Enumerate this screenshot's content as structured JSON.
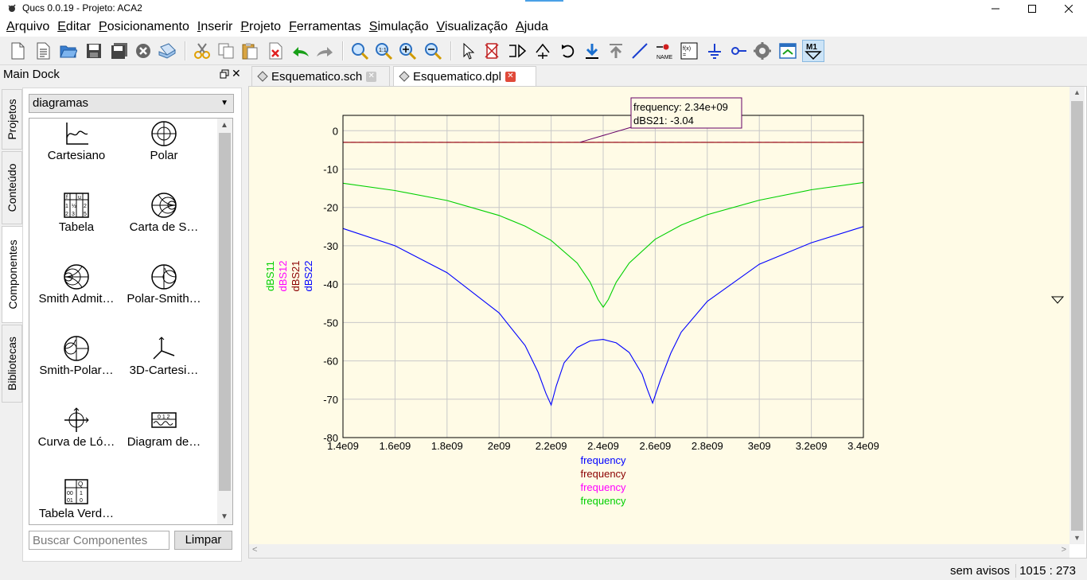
{
  "window": {
    "title": "Qucs 0.0.19 - Projeto: ACA2"
  },
  "menu": [
    "Arquivo",
    "Editar",
    "Posicionamento",
    "Inserir",
    "Projeto",
    "Ferramentas",
    "Simulação",
    "Visualização",
    "Ajuda"
  ],
  "toolbar": {
    "icons": [
      "new-file-icon",
      "new-text-icon",
      "open-icon",
      "save-icon",
      "save-all-icon",
      "close-doc-icon",
      "print-icon",
      "cut-icon",
      "copy-icon",
      "paste-icon",
      "delete-icon",
      "undo-icon",
      "redo-icon",
      "zoom-fit-icon",
      "zoom-1to1-icon",
      "zoom-in-icon",
      "zoom-out-icon",
      "select-icon",
      "deactivate-icon",
      "mirror-x-icon",
      "mirror-y-icon",
      "rotate-icon",
      "go-into-icon",
      "go-up-icon",
      "wire-icon",
      "label-icon",
      "equation-icon",
      "ground-icon",
      "port-icon",
      "simulate-icon",
      "view-data-icon",
      "marker-icon"
    ],
    "name_label": "NAME",
    "marker_label": "M1"
  },
  "dock": {
    "title": "Main Dock",
    "tabs": [
      "Projetos",
      "Conteúdo",
      "Componentes",
      "Bibliotecas"
    ],
    "category": "diagramas",
    "components": [
      {
        "label": "Cartesiano",
        "icon": "cartesian-icon"
      },
      {
        "label": "Polar",
        "icon": "polar-icon"
      },
      {
        "label": "Tabela",
        "icon": "table-icon"
      },
      {
        "label": "Carta de S…",
        "icon": "smith-chart-icon"
      },
      {
        "label": "Smith Admit…",
        "icon": "smith-admittance-icon"
      },
      {
        "label": "Polar-Smith…",
        "icon": "polar-smith-icon"
      },
      {
        "label": "Smith-Polar…",
        "icon": "smith-polar-icon"
      },
      {
        "label": "3D-Cartesi…",
        "icon": "3d-cartesian-icon"
      },
      {
        "label": "Curva de Ló…",
        "icon": "locus-curve-icon"
      },
      {
        "label": "Diagram de…",
        "icon": "timing-diagram-icon"
      },
      {
        "label": "Tabela Verd…",
        "icon": "truth-table-icon"
      }
    ],
    "table_icon_text": [
      "f",
      "u",
      "1",
      "½",
      "2",
      "2",
      "3",
      "5"
    ],
    "timing_icon_text": "0 1 2",
    "truth_icon_text": [
      "Q",
      "00",
      "1",
      "01",
      "0"
    ],
    "search_placeholder": "Buscar Componentes",
    "clear_label": "Limpar"
  },
  "doc_tabs": [
    {
      "label": "Esquematico.sch",
      "active": false,
      "close_color": "#8a8a8a"
    },
    {
      "label": "Esquematico.dpl",
      "active": true,
      "close_color": "#e04a3a"
    }
  ],
  "canvas_bg": "#fffbe6",
  "chart_data": {
    "type": "line",
    "xlabel": "frequency",
    "ylabel": "",
    "xlim": [
      1400000000.0,
      3400000000.0
    ],
    "ylim": [
      -80,
      4
    ],
    "x_ticks": [
      "1.4e09",
      "1.6e09",
      "1.8e09",
      "2e09",
      "2.2e09",
      "2.4e09",
      "2.6e09",
      "2.8e09",
      "3e09",
      "3.2e09",
      "3.4e09"
    ],
    "y_ticks": [
      "0",
      "-10",
      "-20",
      "-30",
      "-40",
      "-50",
      "-60",
      "-70",
      "-80"
    ],
    "grid": true,
    "y_legend": [
      {
        "name": "dBS11",
        "color": "#00d000"
      },
      {
        "name": "dBS12",
        "color": "#ff00ff"
      },
      {
        "name": "dBS21",
        "color": "#8b0000"
      },
      {
        "name": "dBS22",
        "color": "#0000ff"
      }
    ],
    "x_legend": [
      {
        "name": "frequency",
        "color": "#0000ff"
      },
      {
        "name": "frequency",
        "color": "#8b0000"
      },
      {
        "name": "frequency",
        "color": "#ff00ff"
      },
      {
        "name": "frequency",
        "color": "#00d000"
      }
    ],
    "series": [
      {
        "name": "dBS11",
        "color": "#00d000",
        "x": [
          1400000000.0,
          1600000000.0,
          1800000000.0,
          2000000000.0,
          2100000000.0,
          2200000000.0,
          2300000000.0,
          2350000000.0,
          2380000000.0,
          2400000000.0,
          2420000000.0,
          2450000000.0,
          2500000000.0,
          2600000000.0,
          2700000000.0,
          2800000000.0,
          3000000000.0,
          3200000000.0,
          3400000000.0
        ],
        "y": [
          -13.7,
          -15.6,
          -18.2,
          -22.1,
          -24.9,
          -28.6,
          -34.5,
          -39.5,
          -44,
          -46,
          -44,
          -39.5,
          -34.5,
          -28.3,
          -24.6,
          -21.9,
          -18.1,
          -15.4,
          -13.5
        ]
      },
      {
        "name": "dBS12",
        "color": "#ff00ff",
        "x": [
          1400000000.0,
          3400000000.0
        ],
        "y": [
          -3.04,
          -3.04
        ]
      },
      {
        "name": "dBS21",
        "color": "#8b0000",
        "x": [
          1400000000.0,
          3400000000.0
        ],
        "y": [
          -3.04,
          -3.04
        ]
      },
      {
        "name": "dBS22",
        "color": "#0000ff",
        "x": [
          1400000000.0,
          1600000000.0,
          1800000000.0,
          2000000000.0,
          2100000000.0,
          2150000000.0,
          2180000000.0,
          2200000000.0,
          2220000000.0,
          2250000000.0,
          2300000000.0,
          2350000000.0,
          2400000000.0,
          2450000000.0,
          2500000000.0,
          2550000000.0,
          2570000000.0,
          2590000000.0,
          2620000000.0,
          2660000000.0,
          2700000000.0,
          2800000000.0,
          3000000000.0,
          3200000000.0,
          3400000000.0
        ],
        "y": [
          -25.5,
          -30,
          -37,
          -47.5,
          -56,
          -63,
          -68.5,
          -71.5,
          -66.5,
          -60.5,
          -56.5,
          -54.8,
          -54.4,
          -55.3,
          -57.8,
          -63.5,
          -67.5,
          -71,
          -65,
          -58,
          -52.5,
          -44.5,
          -34.8,
          -29.2,
          -25
        ]
      }
    ],
    "marker": {
      "x": 2340000000.0,
      "y": -3.04,
      "line1": "frequency: 2.34e+09",
      "line2": "dBS21: -3.04"
    }
  },
  "status": {
    "message": "sem avisos",
    "coords": "1015 : 273"
  }
}
